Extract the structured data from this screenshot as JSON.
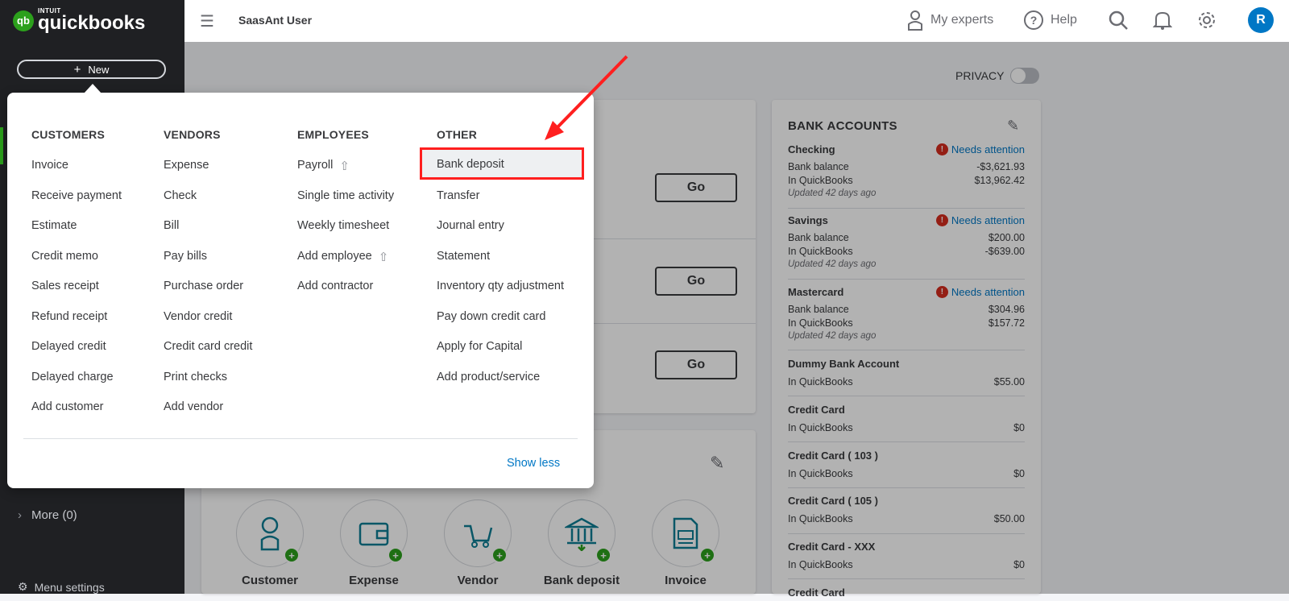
{
  "brand": {
    "intuit": "INTUIT",
    "name": "quickbooks",
    "badge": "qb"
  },
  "sidebar": {
    "new_label": "New",
    "more_label": "More (0)",
    "settings_label": "Menu settings"
  },
  "topbar": {
    "user": "SaasAnt User",
    "my_experts": "My experts",
    "help": "Help",
    "avatar": "R"
  },
  "privacy": {
    "label": "PRIVACY",
    "enabled": false
  },
  "go_buttons": [
    "Go",
    "Go",
    "Go"
  ],
  "new_menu": {
    "columns": [
      {
        "header": "CUSTOMERS",
        "items": [
          {
            "label": "Invoice"
          },
          {
            "label": "Receive payment"
          },
          {
            "label": "Estimate"
          },
          {
            "label": "Credit memo"
          },
          {
            "label": "Sales receipt"
          },
          {
            "label": "Refund receipt"
          },
          {
            "label": "Delayed credit"
          },
          {
            "label": "Delayed charge"
          },
          {
            "label": "Add customer"
          }
        ]
      },
      {
        "header": "VENDORS",
        "items": [
          {
            "label": "Expense"
          },
          {
            "label": "Check"
          },
          {
            "label": "Bill"
          },
          {
            "label": "Pay bills"
          },
          {
            "label": "Purchase order"
          },
          {
            "label": "Vendor credit"
          },
          {
            "label": "Credit card credit"
          },
          {
            "label": "Print checks"
          },
          {
            "label": "Add vendor"
          }
        ]
      },
      {
        "header": "EMPLOYEES",
        "items": [
          {
            "label": "Payroll",
            "upsell": true
          },
          {
            "label": "Single time activity"
          },
          {
            "label": "Weekly timesheet"
          },
          {
            "label": "Add employee",
            "upsell": true
          },
          {
            "label": "Add contractor"
          }
        ]
      },
      {
        "header": "OTHER",
        "items": [
          {
            "label": "Bank deposit",
            "highlighted": true
          },
          {
            "label": "Transfer"
          },
          {
            "label": "Journal entry"
          },
          {
            "label": "Statement"
          },
          {
            "label": "Inventory qty adjustment"
          },
          {
            "label": "Pay down credit card"
          },
          {
            "label": "Apply for Capital"
          },
          {
            "label": "Add product/service"
          }
        ]
      }
    ],
    "show_less": "Show less"
  },
  "shortcuts": [
    {
      "label": "Customer",
      "icon": "customer-icon"
    },
    {
      "label": "Expense",
      "icon": "wallet-icon"
    },
    {
      "label": "Vendor",
      "icon": "cart-icon"
    },
    {
      "label": "Bank deposit",
      "icon": "bank-icon"
    },
    {
      "label": "Invoice",
      "icon": "invoice-icon"
    }
  ],
  "bank_accounts": {
    "title": "BANK ACCOUNTS",
    "accounts": [
      {
        "name": "Checking",
        "attention": "Needs attention",
        "bank_balance_label": "Bank balance",
        "bank_balance": "-$3,621.93",
        "qb_label": "In QuickBooks",
        "qb_balance": "$13,962.42",
        "updated": "Updated 42 days ago"
      },
      {
        "name": "Savings",
        "attention": "Needs attention",
        "bank_balance_label": "Bank balance",
        "bank_balance": "$200.00",
        "qb_label": "In QuickBooks",
        "qb_balance": "-$639.00",
        "updated": "Updated 42 days ago"
      },
      {
        "name": "Mastercard",
        "attention": "Needs attention",
        "bank_balance_label": "Bank balance",
        "bank_balance": "$304.96",
        "qb_label": "In QuickBooks",
        "qb_balance": "$157.72",
        "updated": "Updated 42 days ago"
      },
      {
        "name": "Dummy Bank Account",
        "qb_label": "In QuickBooks",
        "qb_balance": "$55.00"
      },
      {
        "name": "Credit Card",
        "qb_label": "In QuickBooks",
        "qb_balance": "$0"
      },
      {
        "name": "Credit Card ( 103 )",
        "qb_label": "In QuickBooks",
        "qb_balance": "$0"
      },
      {
        "name": "Credit Card ( 105 )",
        "qb_label": "In QuickBooks",
        "qb_balance": "$50.00"
      },
      {
        "name": "Credit Card - XXX",
        "qb_label": "In QuickBooks",
        "qb_balance": "$0"
      },
      {
        "name": "Credit Card"
      }
    ]
  }
}
